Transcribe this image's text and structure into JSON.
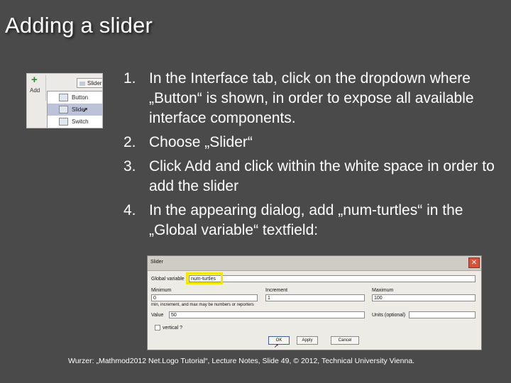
{
  "slide": {
    "title": "Adding a slider",
    "steps": [
      {
        "num": "1.",
        "text": "In the Interface tab, click on the dropdown where „Button“ is shown, in order to expose all available interface components."
      },
      {
        "num": "2.",
        "text": "Choose „Slider“"
      },
      {
        "num": "3.",
        "text": "Click Add and click within the white space in order to add the slider"
      },
      {
        "num": "4.",
        "text": "In the appearing dialog, add „num-turtles“ in the „Global variable“ textfield:"
      }
    ],
    "citation": "Wurzer: „Mathmod2012 Net.Logo Tutorial“, Lecture Notes, Slide 49, © 2012, Technical University Vienna."
  },
  "dropdown_shot": {
    "add_label": "Add",
    "selected": "Slider",
    "options": [
      "Button",
      "Slider",
      "Switch"
    ],
    "icons": [
      "plus-icon",
      "chevron-down-icon",
      "cursor-icon"
    ]
  },
  "dialog": {
    "title": "Slider",
    "close": "✕",
    "global_variable_label": "Global variable",
    "global_variable_value": "num-turtles",
    "minimum_label": "Minimum",
    "minimum_value": "0",
    "increment_label": "Increment",
    "increment_value": "1",
    "maximum_label": "Maximum",
    "maximum_value": "100",
    "note": "min, increment, and max may be numbers or reporters",
    "value_label": "Value",
    "value_value": "50",
    "units_label": "Units (optional)",
    "units_value": "",
    "vertical_label": "vertical ?",
    "buttons": {
      "ok": "OK",
      "apply": "Apply",
      "cancel": "Cancel"
    }
  },
  "colors": {
    "background": "#4a4a4a",
    "text": "#ffffff",
    "highlight": "#f5e600",
    "close_button": "#d5533a"
  }
}
